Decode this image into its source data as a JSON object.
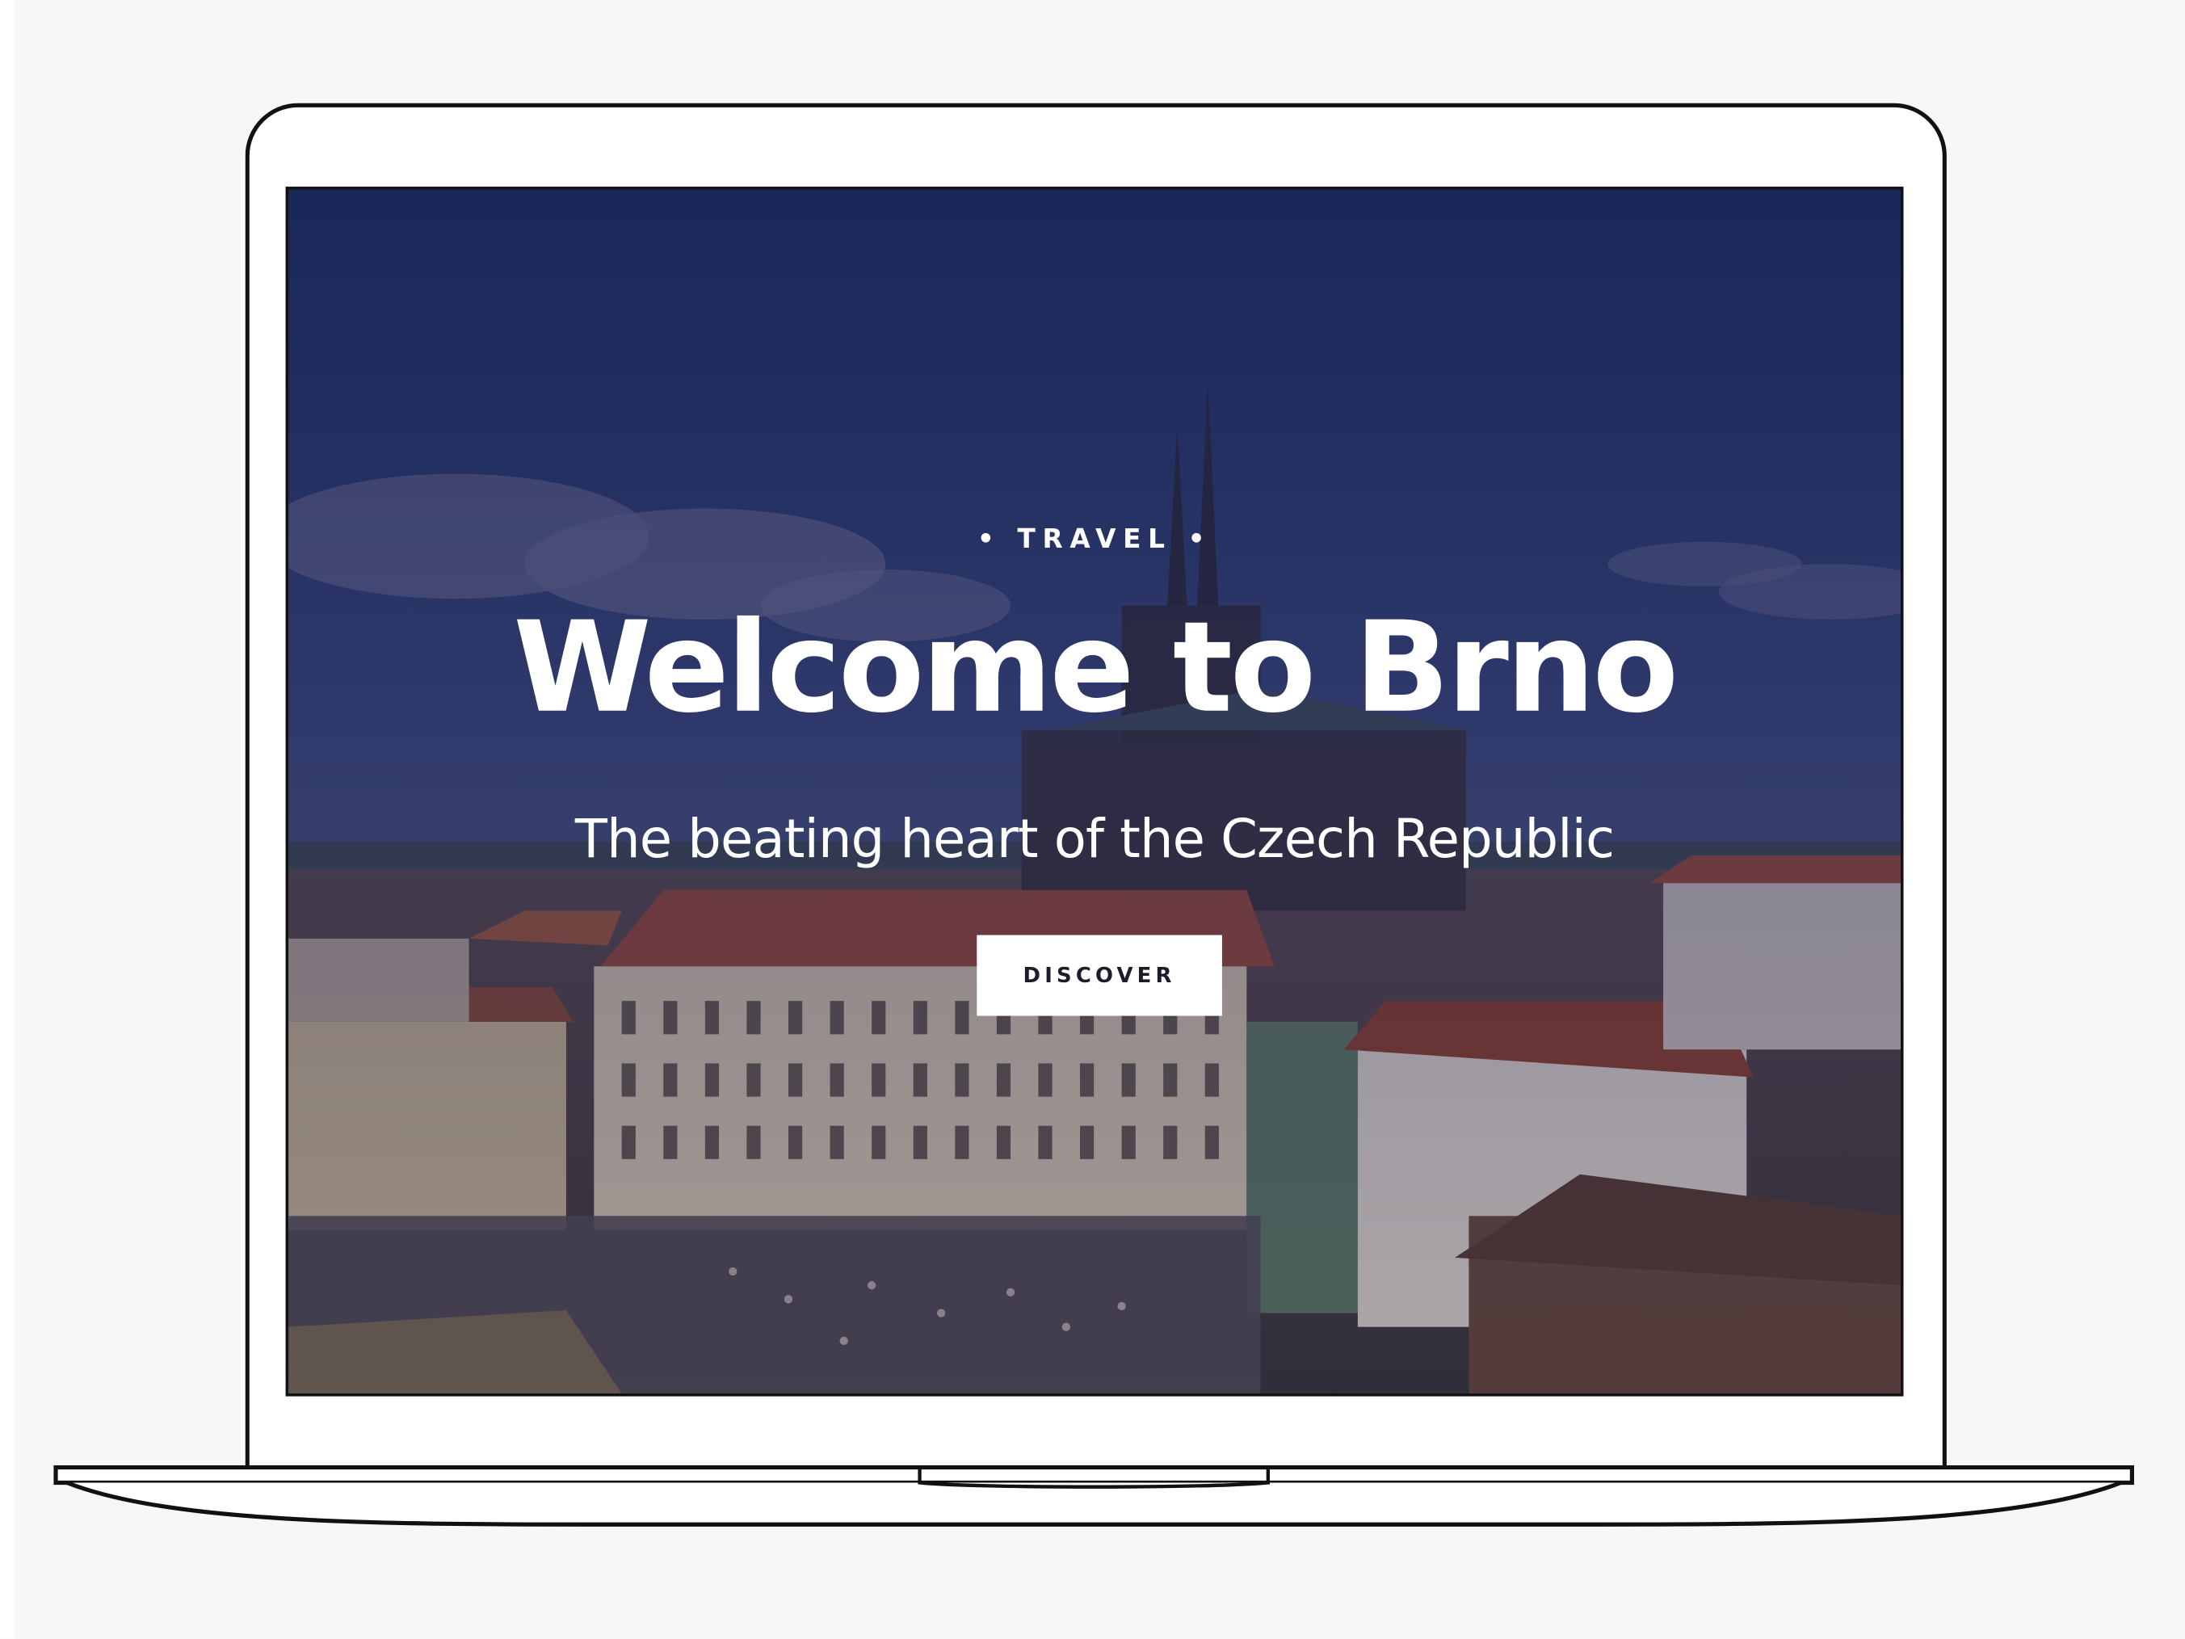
{
  "hero": {
    "eyebrow": "• TRAVEL •",
    "title": "Welcome to Brno",
    "subtitle": "The beating heart of the Czech Republic",
    "cta_label": "DISCOVER"
  },
  "colors": {
    "page_background": "#f7f7f7",
    "device_outline": "#111111",
    "overlay_tint": "#1e2a5a",
    "text": "#ffffff",
    "button_background": "#ffffff",
    "button_text": "#1c1c2a"
  }
}
